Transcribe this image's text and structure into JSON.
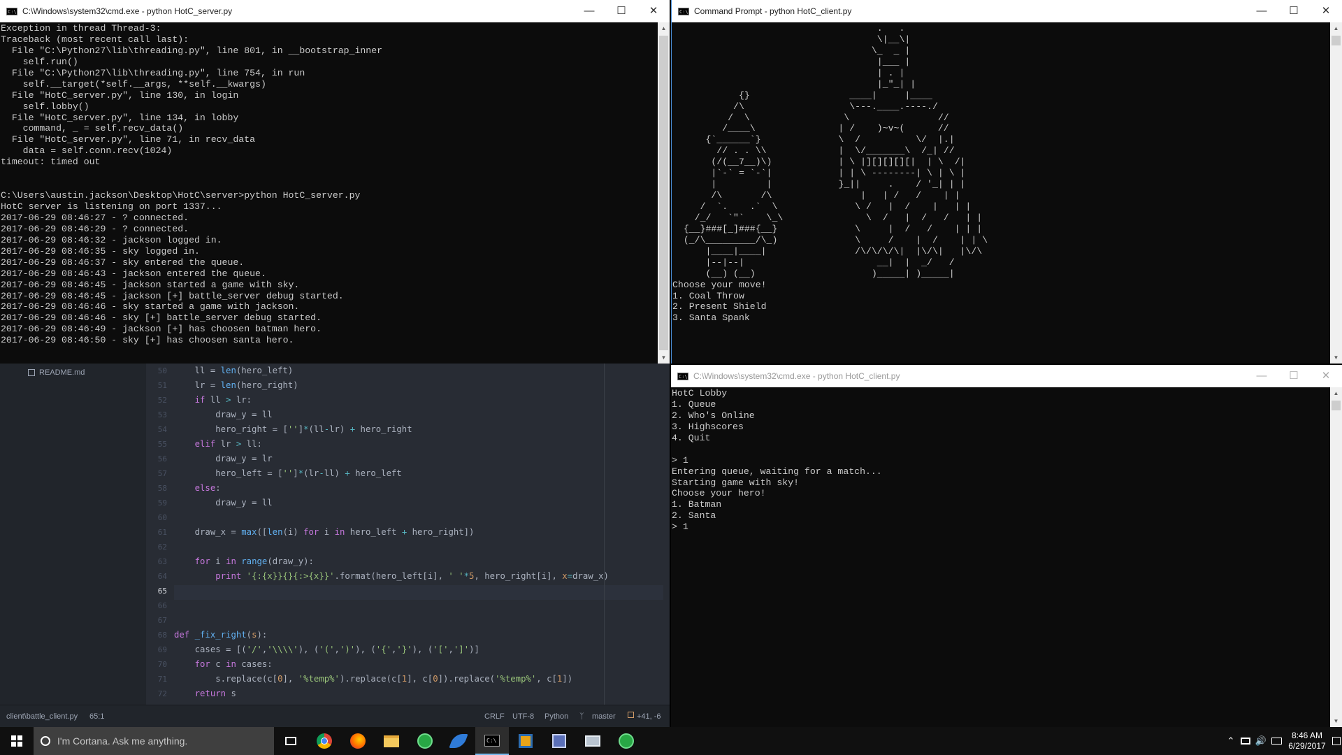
{
  "server_window": {
    "title": "C:\\Windows\\system32\\cmd.exe - python  HotC_server.py",
    "lines": [
      "Exception in thread Thread-3:",
      "Traceback (most recent call last):",
      "  File \"C:\\Python27\\lib\\threading.py\", line 801, in __bootstrap_inner",
      "    self.run()",
      "  File \"C:\\Python27\\lib\\threading.py\", line 754, in run",
      "    self.__target(*self.__args, **self.__kwargs)",
      "  File \"HotC_server.py\", line 130, in login",
      "    self.lobby()",
      "  File \"HotC_server.py\", line 134, in lobby",
      "    command, _ = self.recv_data()",
      "  File \"HotC_server.py\", line 71, in recv_data",
      "    data = self.conn.recv(1024)",
      "timeout: timed out",
      "",
      "",
      "C:\\Users\\austin.jackson\\Desktop\\HotC\\server>python HotC_server.py",
      "HotC server is listening on port 1337...",
      "2017-06-29 08:46:27 - ? connected.",
      "2017-06-29 08:46:29 - ? connected.",
      "2017-06-29 08:46:32 - jackson logged in.",
      "2017-06-29 08:46:35 - sky logged in.",
      "2017-06-29 08:46:37 - sky entered the queue.",
      "2017-06-29 08:46:43 - jackson entered the queue.",
      "2017-06-29 08:46:45 - jackson started a game with sky.",
      "2017-06-29 08:46:45 - jackson [+] battle_server debug started.",
      "2017-06-29 08:46:46 - sky started a game with jackson.",
      "2017-06-29 08:46:46 - sky [+] battle_server debug started.",
      "2017-06-29 08:46:49 - jackson [+] has choosen batman hero.",
      "2017-06-29 08:46:50 - sky [+] has choosen santa hero."
    ]
  },
  "client_top_window": {
    "title": "Command Prompt - python  HotC_client.py",
    "lines": [
      "                                     .   .",
      "                                     \\|__\\|",
      "                                    \\_  _ |",
      "                                     |___ |",
      "                                     | . |",
      "                                     |_\"_| |",
      "            {}                  ____|     |____",
      "           /\\                   \\---.____.----./",
      "          /  \\                 \\                //",
      "         /____\\               | /    )~v~(      //",
      "      {`______`}              \\  /          \\/  |.|",
      "        // . . \\\\             |  \\/_______\\  /_| //",
      "       (/(__7__)\\)            | \\ |][][][][|  | \\  /|",
      "       |`-` = `-`|            | | \\ --------| \\ | \\ |",
      "       |         |            }_||     .    / '_| | |",
      "       /\\       /\\                |   | /   /    | |",
      "     /  `.    .`  \\              \\ /   |  /    |   | |",
      "    /_/   `\"`    \\_\\               \\  /   |  /   /   | |",
      "  {__}###[_]###{__}              \\     |  /   /    | | |",
      "  (_/\\_________/\\_)              \\     /    |  /    | | \\",
      "      |____|____|                /\\/\\/\\/\\|  |\\/\\|   |\\/\\",
      "      |--|--|                        __|  |  _/   /",
      "      (__) (__)                     )_____| )_____|",
      "Choose your move!",
      "1. Coal Throw",
      "2. Present Shield",
      "3. Santa Spank"
    ]
  },
  "client_bottom_window": {
    "title": "C:\\Windows\\system32\\cmd.exe - python  HotC_client.py",
    "lines": [
      "HotC Lobby",
      "1. Queue",
      "2. Who's Online",
      "3. Highscores",
      "4. Quit",
      "",
      "> 1",
      "Entering queue, waiting for a match...",
      "Starting game with sky!",
      "Choose your hero!",
      "1. Batman",
      "2. Santa",
      "> 1"
    ]
  },
  "editor": {
    "sidebar_file": "README.md",
    "line_numbers": [
      "50",
      "51",
      "52",
      "53",
      "54",
      "55",
      "56",
      "57",
      "58",
      "59",
      "60",
      "61",
      "62",
      "63",
      "64",
      "65",
      "66",
      "67",
      "68",
      "69",
      "70",
      "71",
      "72"
    ],
    "current_line": "65",
    "status": {
      "path": "client\\battle_client.py",
      "cursor": "65:1",
      "line_ending": "CRLF",
      "encoding": "UTF-8",
      "grammar": "Python",
      "branch": "master",
      "diff": "+41, -6"
    }
  },
  "taskbar": {
    "search_placeholder": "I'm Cortana. Ask me anything.",
    "time": "8:46 AM",
    "date": "6/29/2017"
  }
}
